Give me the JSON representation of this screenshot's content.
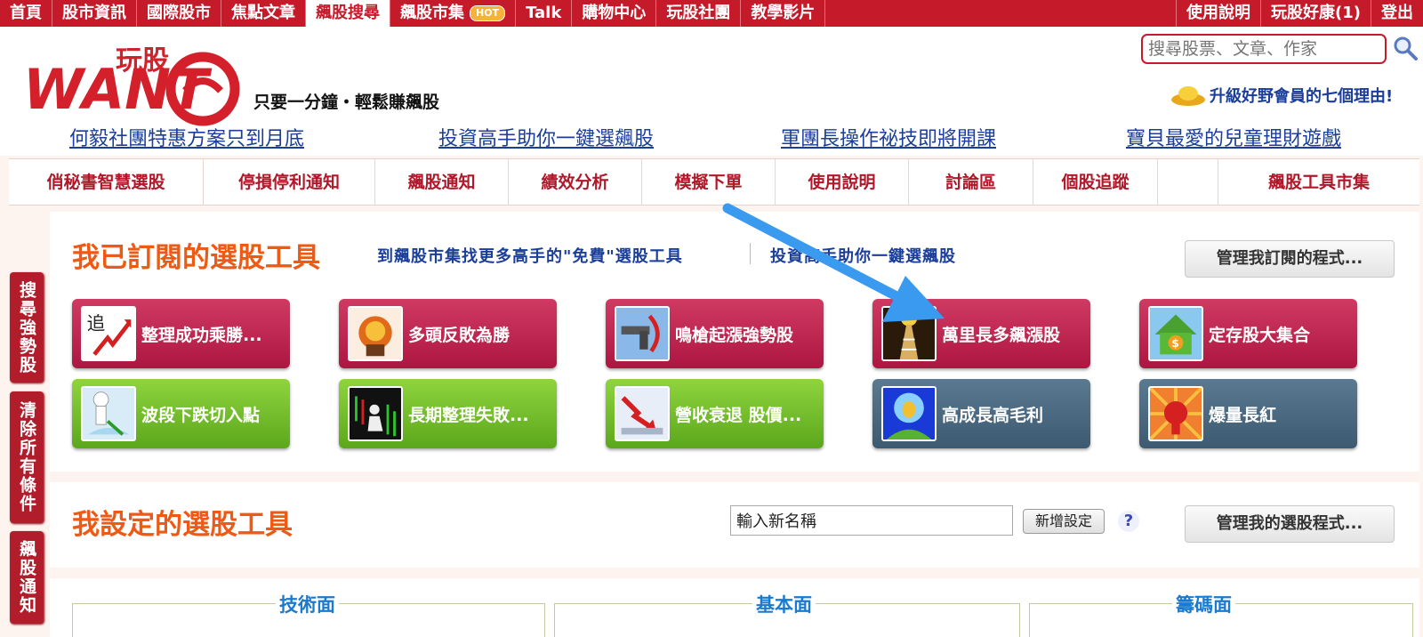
{
  "topnav": {
    "items": [
      "首頁",
      "股市資訊",
      "國際股市",
      "焦點文章",
      "飆股搜尋",
      "飆股市集",
      "Talk",
      "購物中心",
      "玩股社團",
      "教學影片"
    ],
    "active_index": 4,
    "hot_badge": "HOT",
    "right_items": [
      "使用說明",
      "玩股好康(1)",
      "登出"
    ]
  },
  "header": {
    "logo_cn": "玩股",
    "logo_en": "WANT",
    "slogan": "只要一分鐘・輕鬆賺飆股",
    "search_placeholder": "搜尋股票、文章、作家",
    "upgrade_text": "升級好野會員的七個理由!",
    "promo_links": [
      "何毅社團特惠方案只到月底",
      "投資高手助你一鍵選飆股",
      "軍團長操作祕技即將開課",
      "寶貝最愛的兒童理財遊戲"
    ]
  },
  "subnav": {
    "items": [
      "俏秘書智慧選股",
      "停損停利通知",
      "飆股通知",
      "績效分析",
      "模擬下單",
      "使用說明",
      "討論區",
      "個股追蹤",
      "",
      "飆股工具市集"
    ]
  },
  "sidetabs": [
    "搜尋強勢股",
    "清除所有條件",
    "飆股通知"
  ],
  "subscribed": {
    "title": "我已訂閱的選股工具",
    "link1": "到飆股市集找更多高手的\"免費\"選股工具",
    "link2": "投資高手助你一鍵選飆股",
    "manage_button": "管理我訂閱的程式...",
    "tools": [
      {
        "label": "整理成功乘勝...",
        "color": "red",
        "icon": "chase-arrow-icon"
      },
      {
        "label": "多頭反敗為勝",
        "color": "red",
        "icon": "fire-fist-icon"
      },
      {
        "label": "鳴槍起漲強勢股",
        "color": "red",
        "icon": "pistol-icon"
      },
      {
        "label": "萬里長多飆漲股",
        "color": "red",
        "icon": "stairs-icon"
      },
      {
        "label": "定存股大集合",
        "color": "red",
        "icon": "money-house-icon"
      },
      {
        "label": "波段下跌切入點",
        "color": "green",
        "icon": "climber-icon"
      },
      {
        "label": "長期整理失敗...",
        "color": "green",
        "icon": "falling-chart-icon"
      },
      {
        "label": "營收衰退 股價...",
        "color": "green",
        "icon": "down-arrow-icon"
      },
      {
        "label": "高成長高毛利",
        "color": "slate",
        "icon": "golden-egg-icon"
      },
      {
        "label": "爆量長紅",
        "color": "slate",
        "icon": "red-fist-icon"
      }
    ]
  },
  "custom": {
    "title": "我設定的選股工具",
    "name_placeholder": "輸入新名稱",
    "add_button": "新增設定",
    "help": "?",
    "manage_button": "管理我的選股程式..."
  },
  "categories": [
    "技術面",
    "基本面",
    "籌碼面"
  ],
  "colors": {
    "brand_red": "#c41a2a",
    "title_orange": "#ee5a14",
    "link_blue": "#1a3e9a",
    "arrow_blue": "#3a9af0"
  }
}
